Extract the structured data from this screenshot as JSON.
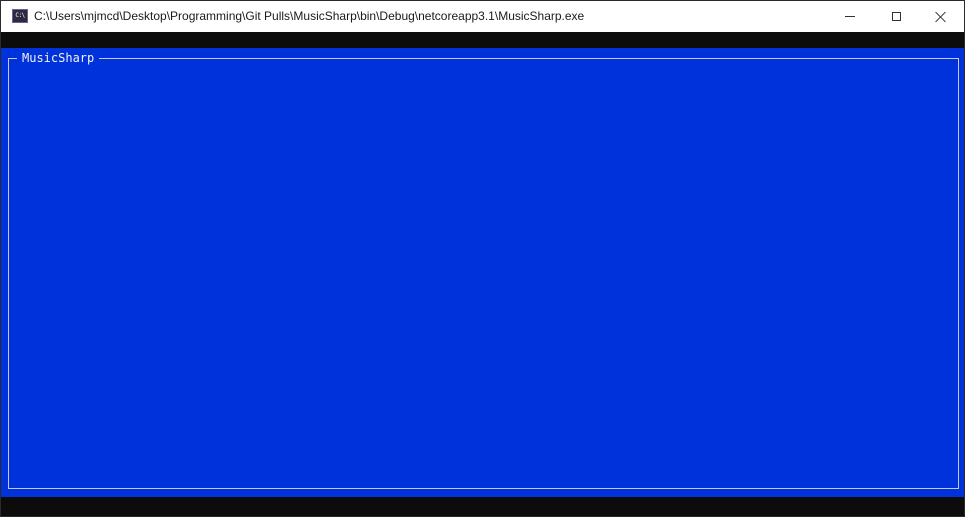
{
  "window": {
    "title": "C:\\Users\\mjmcd\\Desktop\\Programming\\Git Pulls\\MusicSharp\\bin\\Debug\\netcoreapp3.1\\MusicSharp.exe",
    "icon": "console-app-icon",
    "icon_glyph": "C:\\",
    "controls": {
      "minimize": "minimize-icon",
      "maximize": "maximize-icon",
      "close": "close-icon"
    }
  },
  "console": {
    "background": "#0032dc",
    "frame_title": "MusicSharp"
  }
}
